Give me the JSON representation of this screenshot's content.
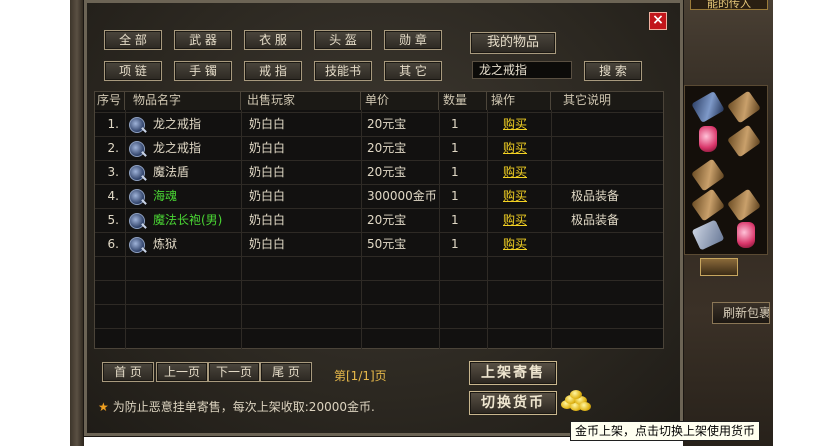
{
  "right_tab": "能的传入",
  "right_refresh": "刷新包裹",
  "close_label": "×",
  "categories_row1": [
    "全 部",
    "武 器",
    "衣 服",
    "头 盔",
    "勋 章"
  ],
  "categories_row2": [
    "项 链",
    "手 镯",
    "戒 指",
    "技能书",
    "其 它"
  ],
  "my_items_label": "我的物品",
  "search": {
    "value": "龙之戒指",
    "button": "搜 索"
  },
  "table": {
    "headers": [
      "序号",
      "物品名字",
      "出售玩家",
      "单价",
      "数量",
      "操作",
      "其它说明"
    ],
    "rows": [
      {
        "index": "1.",
        "name": "龙之戒指",
        "seller": "奶白白",
        "price": "20元宝",
        "qty": "1",
        "action": "购买",
        "note": "",
        "highlight": false
      },
      {
        "index": "2.",
        "name": "龙之戒指",
        "seller": "奶白白",
        "price": "20元宝",
        "qty": "1",
        "action": "购买",
        "note": "",
        "highlight": false
      },
      {
        "index": "3.",
        "name": "魔法盾",
        "seller": "奶白白",
        "price": "20元宝",
        "qty": "1",
        "action": "购买",
        "note": "",
        "highlight": false
      },
      {
        "index": "4.",
        "name": "海魂",
        "seller": "奶白白",
        "price": "300000金币",
        "qty": "1",
        "action": "购买",
        "note": "极品装备",
        "highlight": true
      },
      {
        "index": "5.",
        "name": "魔法长袍(男)",
        "seller": "奶白白",
        "price": "20元宝",
        "qty": "1",
        "action": "购买",
        "note": "极品装备",
        "highlight": true
      },
      {
        "index": "6.",
        "name": "炼狱",
        "seller": "奶白白",
        "price": "50元宝",
        "qty": "1",
        "action": "购买",
        "note": "",
        "highlight": false
      }
    ]
  },
  "pager": {
    "first": "首 页",
    "prev": "上一页",
    "next": "下一页",
    "last": "尾 页",
    "info": "第[1/1]页"
  },
  "list_button": "上架寄售",
  "switch_button": "切换货币",
  "notice": "为防止恶意挂单寄售，每次上架收取:20000金币.",
  "tooltip": "金币上架，点击切换上架使用货币",
  "colors": {
    "highlight_green": "#4ad634",
    "link_yellow": "#f4d223",
    "close_red": "#c2161b",
    "page_gold": "#e6b84a"
  }
}
